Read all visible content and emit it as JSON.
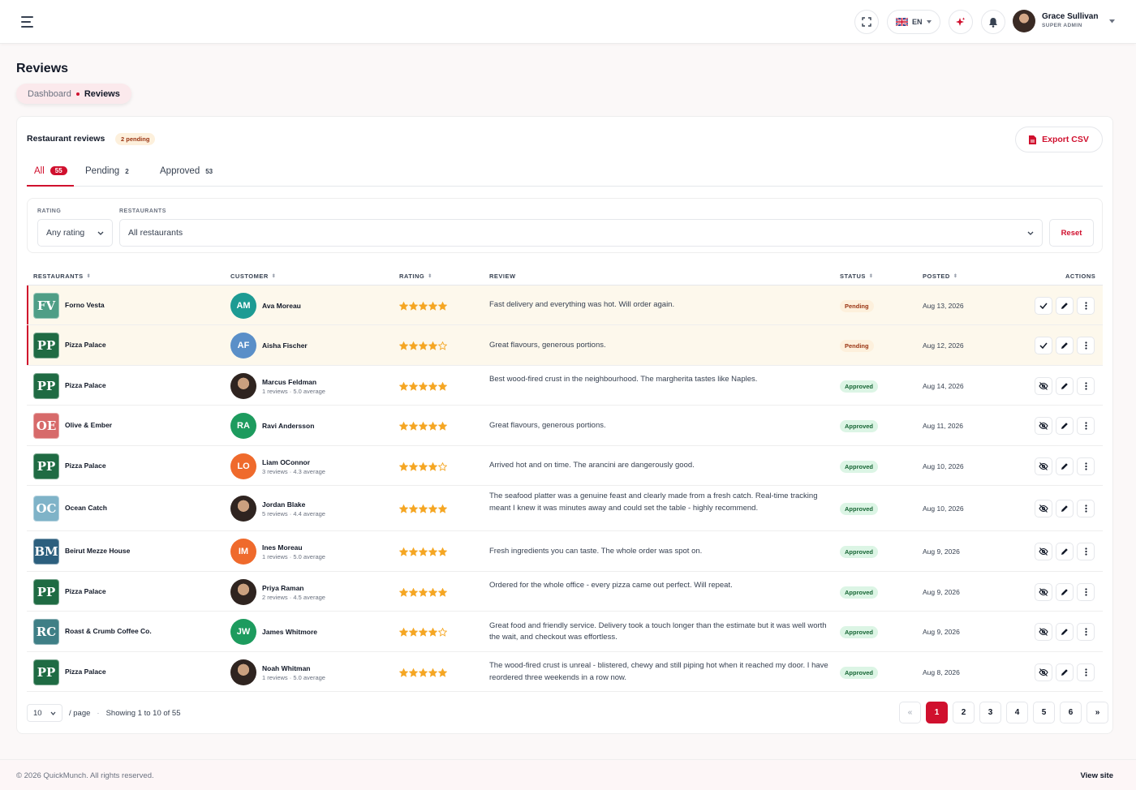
{
  "colors": {
    "accent": "#d0102e",
    "pending_bg": "#fdf0dc",
    "approved_bg": "#dcf5e5",
    "star": "#f5a623"
  },
  "header": {
    "lang": "EN",
    "user_name": "Grace Sullivan",
    "user_role": "SUPER ADMIN",
    "icons": [
      "menu-icon",
      "fullscreen-icon",
      "flag-uk-icon",
      "sparkle-icon",
      "bell-icon",
      "chevron-down-icon"
    ]
  },
  "page": {
    "title": "Reviews",
    "breadcrumb": [
      "Dashboard",
      "Reviews"
    ]
  },
  "card": {
    "title": "Restaurant reviews",
    "pending_badge": "2 pending",
    "export_label": "Export CSV"
  },
  "tabs": [
    {
      "label": "All",
      "count": "55",
      "active": true
    },
    {
      "label": "Pending",
      "count": "2"
    },
    {
      "label": "Approved",
      "count": "53"
    }
  ],
  "filters": {
    "rating_label": "RATING",
    "rating_value": "Any rating",
    "restaurants_label": "RESTAURANTS",
    "restaurants_value": "All restaurants",
    "reset_label": "Reset"
  },
  "columns": [
    "RESTAURANTS",
    "CUSTOMER",
    "RATING",
    "REVIEW",
    "STATUS",
    "POSTED",
    "ACTIONS"
  ],
  "rows": [
    {
      "restaurant": "Forno Vesta",
      "logo": "FV",
      "logo_color": "#4f9e86",
      "customer": "Ava Moreau",
      "initials": "AM",
      "avatar_color": "#1d9b93",
      "meta": "",
      "rating": 5,
      "review": "Fast delivery and everything was hot. Will order again.",
      "status": "Pending",
      "posted": "Aug 13, 2026"
    },
    {
      "restaurant": "Pizza Palace",
      "logo": "PP",
      "logo_color": "#1f6b43",
      "customer": "Aisha Fischer",
      "initials": "AF",
      "avatar_color": "#5a8fc8",
      "meta": "",
      "rating": 4,
      "review": "Great flavours, generous portions.",
      "status": "Pending",
      "posted": "Aug 12, 2026"
    },
    {
      "restaurant": "Pizza Palace",
      "logo": "PP",
      "logo_color": "#1f6b43",
      "customer": "Marcus Feldman",
      "initials": "",
      "avatar_color": "",
      "meta": "1 reviews · 5.0 average",
      "rating": 5,
      "review": "Best wood-fired crust in the neighbourhood. The margherita tastes like Naples.",
      "status": "Approved",
      "posted": "Aug 14, 2026"
    },
    {
      "restaurant": "Olive & Ember",
      "logo": "OE",
      "logo_color": "#d76a6a",
      "customer": "Ravi Andersson",
      "initials": "RA",
      "avatar_color": "#1d9b5e",
      "meta": "",
      "rating": 5,
      "review": "Great flavours, generous portions.",
      "status": "Approved",
      "posted": "Aug 11, 2026"
    },
    {
      "restaurant": "Pizza Palace",
      "logo": "PP",
      "logo_color": "#1f6b43",
      "customer": "Liam OConnor",
      "initials": "LO",
      "avatar_color": "#ef6a2c",
      "meta": "3 reviews · 4.3 average",
      "rating": 4,
      "review": "Arrived hot and on time. The arancini are dangerously good.",
      "status": "Approved",
      "posted": "Aug 10, 2026"
    },
    {
      "restaurant": "Ocean Catch",
      "logo": "OC",
      "logo_color": "#7fb3c8",
      "customer": "Jordan Blake",
      "initials": "",
      "avatar_color": "",
      "meta": "5 reviews · 4.4 average",
      "rating": 5,
      "review": "The seafood platter was a genuine feast and clearly made from a fresh catch. Real-time tracking meant I knew it was minutes away and could set the table - highly recommend.",
      "status": "Approved",
      "posted": "Aug 10, 2026"
    },
    {
      "restaurant": "Beirut Mezze House",
      "logo": "BM",
      "logo_color": "#2c5f7e",
      "customer": "Ines Moreau",
      "initials": "IM",
      "avatar_color": "#ef6a2c",
      "meta": "1 reviews · 5.0 average",
      "rating": 5,
      "review": "Fresh ingredients you can taste. The whole order was spot on.",
      "status": "Approved",
      "posted": "Aug 9, 2026"
    },
    {
      "restaurant": "Pizza Palace",
      "logo": "PP",
      "logo_color": "#1f6b43",
      "customer": "Priya Raman",
      "initials": "",
      "avatar_color": "",
      "meta": "2 reviews · 4.5 average",
      "rating": 5,
      "review": "Ordered for the whole office - every pizza came out perfect. Will repeat.",
      "status": "Approved",
      "posted": "Aug 9, 2026"
    },
    {
      "restaurant": "Roast & Crumb Coffee Co.",
      "logo": "RC",
      "logo_color": "#3f7f86",
      "customer": "James Whitmore",
      "initials": "JW",
      "avatar_color": "#1d9b5e",
      "meta": "",
      "rating": 4,
      "review": "Great food and friendly service. Delivery took a touch longer than the estimate but it was well worth the wait, and checkout was effortless.",
      "status": "Approved",
      "posted": "Aug 9, 2026"
    },
    {
      "restaurant": "Pizza Palace",
      "logo": "PP",
      "logo_color": "#1f6b43",
      "customer": "Noah Whitman",
      "initials": "",
      "avatar_color": "",
      "meta": "1 reviews · 5.0 average",
      "rating": 5,
      "review": "The wood-fired crust is unreal - blistered, chewy and still piping hot when it reached my door. I have reordered three weekends in a row now.",
      "status": "Approved",
      "posted": "Aug 8, 2026"
    }
  ],
  "pagination": {
    "per_page": "10",
    "per_page_label": "/ page",
    "showing": "Showing 1 to 10 of 55",
    "prev": "«",
    "next": "»",
    "pages": [
      "1",
      "2",
      "3",
      "4",
      "5",
      "6"
    ]
  },
  "footer": {
    "copyright": "© 2026 QuickMunch. All rights reserved.",
    "view_site": "View site"
  }
}
